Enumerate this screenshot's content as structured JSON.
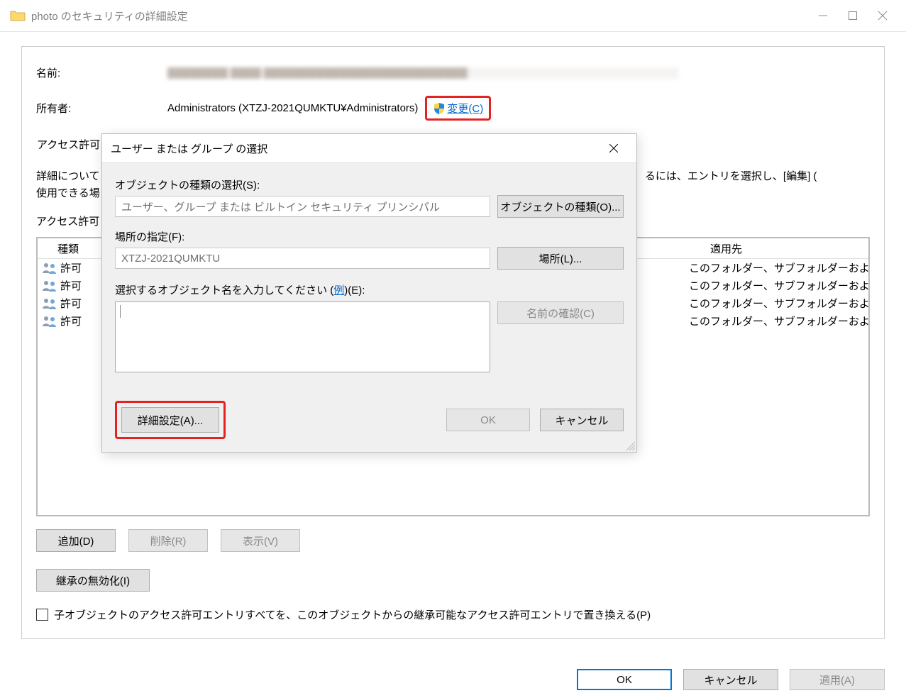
{
  "window": {
    "title": "photo のセキュリティの詳細設定"
  },
  "header": {
    "name_label": "名前:",
    "owner_label": "所有者:",
    "owner_value": "Administrators (XTZJ-2021QUMKTU¥Administrators)",
    "change_link": "変更(C)"
  },
  "tabs": {
    "permissions": "アクセス許可"
  },
  "info": {
    "line1_a": "詳細について",
    "line1_b": "るには、エントリを選択し、[編集] (",
    "line2": "使用できる場",
    "list_label": "アクセス許可"
  },
  "perm_table": {
    "col_type": "種類",
    "col_applies": "適用先",
    "rows": [
      {
        "type": "許可",
        "applies": "このフォルダー、サブフォルダーおよびファイ..."
      },
      {
        "type": "許可",
        "applies": "このフォルダー、サブフォルダーおよびファイ..."
      },
      {
        "type": "許可",
        "applies": "このフォルダー、サブフォルダーおよびファイ..."
      },
      {
        "type": "許可",
        "applies": "このフォルダー、サブフォルダーおよびファイ..."
      }
    ]
  },
  "buttons": {
    "add": "追加(D)",
    "remove": "削除(R)",
    "view": "表示(V)",
    "disable_inherit": "継承の無効化(I)",
    "ok": "OK",
    "cancel": "キャンセル",
    "apply": "適用(A)"
  },
  "checkbox": {
    "replace_child": "子オブジェクトのアクセス許可エントリすべてを、このオブジェクトからの継承可能なアクセス許可エントリで置き換える(P)"
  },
  "modal": {
    "title": "ユーザー または グループ の選択",
    "obj_type_label": "オブジェクトの種類の選択(S):",
    "obj_type_value": "ユーザー、グループ または ビルトイン セキュリティ プリンシパル",
    "obj_type_btn": "オブジェクトの種類(O)...",
    "from_label": "場所の指定(F):",
    "from_value": "XTZJ-2021QUMKTU",
    "from_btn": "場所(L)...",
    "enter_label_a": "選択するオブジェクト名を入力してください (",
    "enter_label_link": "例",
    "enter_label_b": ")(E):",
    "check_name_btn": "名前の確認(C)",
    "advanced_btn": "詳細設定(A)...",
    "ok": "OK",
    "cancel": "キャンセル"
  }
}
